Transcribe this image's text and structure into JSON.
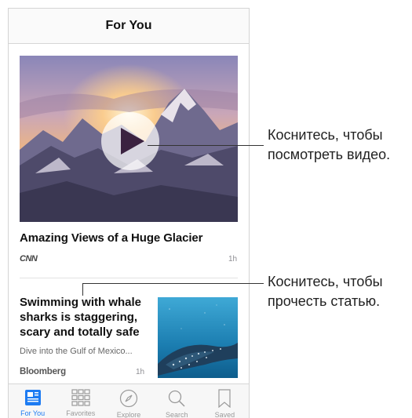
{
  "navbar": {
    "title": "For You"
  },
  "story1": {
    "title": "Amazing Views of a Huge Glacier",
    "source": "CNN",
    "time": "1h"
  },
  "story2": {
    "title": "Swimming with whale sharks is staggering, scary and totally safe",
    "subtitle": "Dive into the Gulf of Mexico...",
    "source": "Bloomberg",
    "time": "1h"
  },
  "tabs": [
    {
      "label": "For You",
      "icon": "news-icon",
      "active": true
    },
    {
      "label": "Favorites",
      "icon": "grid-icon",
      "active": false
    },
    {
      "label": "Explore",
      "icon": "compass-icon",
      "active": false
    },
    {
      "label": "Search",
      "icon": "search-icon",
      "active": false
    },
    {
      "label": "Saved",
      "icon": "bookmark-icon",
      "active": false
    }
  ],
  "callouts": {
    "video_line1": "Коснитесь, чтобы",
    "video_line2": "посмотреть видео.",
    "article_line1": "Коснитесь, чтобы",
    "article_line2": "прочесть статью."
  },
  "colors": {
    "accent": "#1e7cf2",
    "inactive": "#9a9a9a"
  }
}
